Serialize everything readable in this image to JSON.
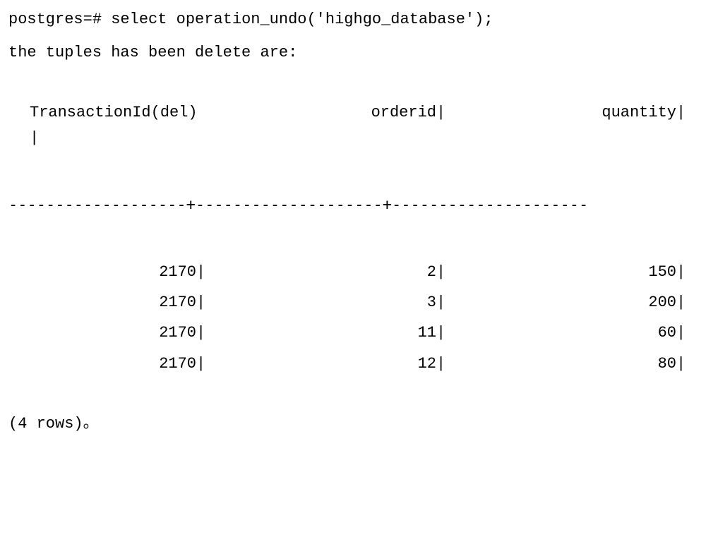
{
  "prompt": "postgres=#",
  "command": "select operation_undo('highgo_database');",
  "message": "the tuples has been delete are:",
  "columns": {
    "col1": "TransactionId(del)",
    "col2": "orderid",
    "col3": "quantity"
  },
  "separator": "-------------------+--------------------+---------------------",
  "rows": [
    {
      "transaction_id": "2170",
      "orderid": "2",
      "quantity": "150"
    },
    {
      "transaction_id": "2170",
      "orderid": "3",
      "quantity": "200"
    },
    {
      "transaction_id": "2170",
      "orderid": "11",
      "quantity": "60"
    },
    {
      "transaction_id": "2170",
      "orderid": "12",
      "quantity": "80"
    }
  ],
  "footer": "(4 rows)。",
  "pipe": "|"
}
